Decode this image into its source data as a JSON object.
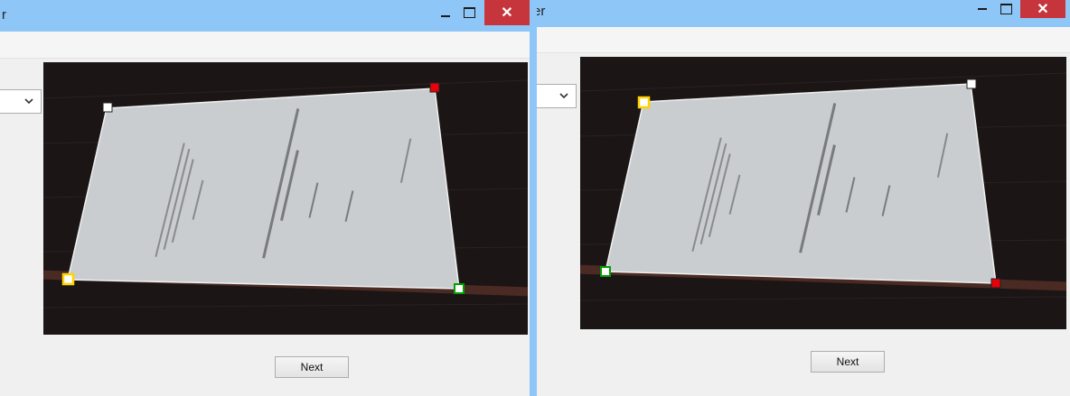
{
  "windows": [
    {
      "title": "r",
      "controls": {
        "minimize": "–",
        "maximize": "☐",
        "close": "✕"
      },
      "dropdown": {
        "selected": "",
        "icon": "chevron-down-icon"
      },
      "next_button": "Next",
      "corner_handle_colors": [
        "#ffffff",
        "#e8000b",
        "#00a000",
        "#ffd200"
      ]
    },
    {
      "title": "er",
      "controls": {
        "minimize": "–",
        "maximize": "☐",
        "close": "✕"
      },
      "dropdown": {
        "selected": "",
        "icon": "chevron-down-icon"
      },
      "next_button": "Next",
      "corner_handle_colors": [
        "#ffd200",
        "#ffffff",
        "#e8000b",
        "#00a000"
      ]
    }
  ],
  "colors": {
    "titlebar": "#8ec6f7",
    "close_button": "#c7353c",
    "window_background": "#f0f0f0",
    "photo_background": "#1b1516",
    "paper": "#c9cdcf"
  }
}
